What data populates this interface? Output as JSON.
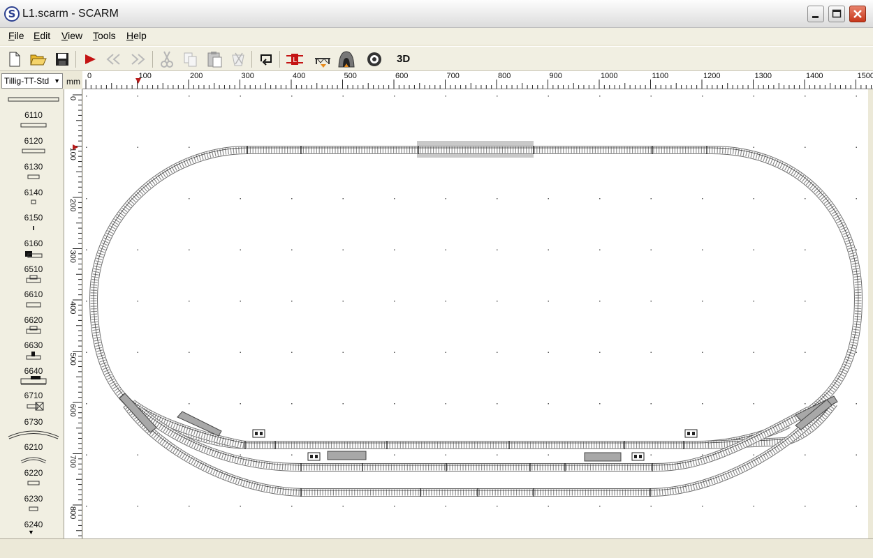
{
  "window": {
    "title": "L1.scarm - SCARM",
    "icon": "S"
  },
  "menu": [
    {
      "key": "F",
      "rest": "ile"
    },
    {
      "key": "E",
      "rest": "dit"
    },
    {
      "key": "V",
      "rest": "iew"
    },
    {
      "key": "T",
      "rest": "ools"
    },
    {
      "key": "H",
      "rest": "elp"
    }
  ],
  "toolbar": {
    "buttons": [
      "new-file",
      "open-folder",
      "save",
      "play",
      "step-back",
      "step-forward",
      "cut",
      "copy",
      "paste",
      "delete",
      "loop",
      "red-marker",
      "bridge",
      "tunnel",
      "track-reel"
    ],
    "label_3d": "3D"
  },
  "library": {
    "selected": "Tillig-TT-Std",
    "unit": "mm"
  },
  "palette": [
    "6110",
    "6120",
    "6130",
    "6140",
    "6150",
    "6160",
    "6510",
    "6610",
    "6620",
    "6630",
    "6640",
    "6710",
    "6730",
    "6210",
    "6220",
    "6230",
    "6240"
  ],
  "rulers": {
    "h_ticks": [
      "0",
      "100",
      "200",
      "300",
      "400",
      "500",
      "600",
      "700",
      "800",
      "900",
      "1000",
      "1100",
      "1200",
      "1300",
      "1400",
      "1500"
    ],
    "v_ticks": [
      "0",
      "100",
      "200",
      "300",
      "400",
      "500",
      "600",
      "700",
      "800"
    ]
  },
  "colors": {
    "track": "#7d7d7d",
    "tie": "#555555",
    "selection": "#c9c9c9",
    "marker": "#b81c1c"
  }
}
